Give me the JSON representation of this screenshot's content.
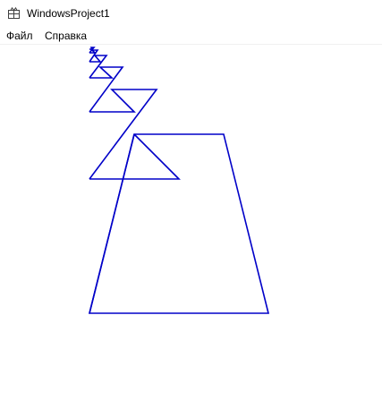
{
  "window": {
    "title": "WindowsProject1",
    "icon": "app-window-icon"
  },
  "menu": {
    "items": [
      {
        "label": "Файл"
      },
      {
        "label": "Справка"
      }
    ]
  },
  "canvas": {
    "stroke_color": "#0000c8",
    "shape": "nested-triangles"
  }
}
